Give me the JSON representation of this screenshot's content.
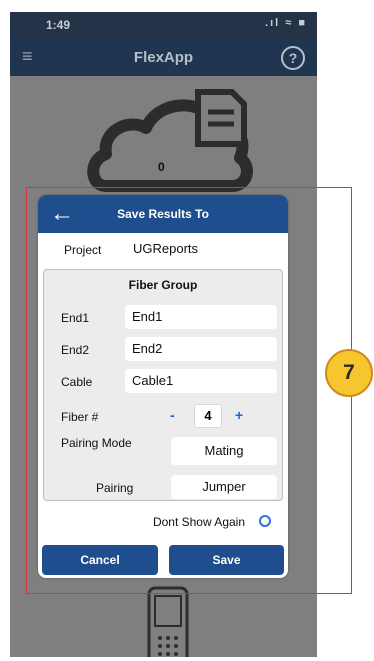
{
  "status_bar": {
    "time": "1:49",
    "icons": ".ıl ≈ ■"
  },
  "navbar": {
    "title": "FlexApp",
    "help_glyph": "?"
  },
  "background": {
    "cloud_count": "0"
  },
  "dialog": {
    "title": "Save Results To",
    "project": {
      "label": "Project",
      "value": "UGReports"
    },
    "fiber_group": {
      "title": "Fiber Group",
      "end1": {
        "label": "End1",
        "value": "End1"
      },
      "end2": {
        "label": "End2",
        "value": "End2"
      },
      "cable": {
        "label": "Cable",
        "value": "Cable1"
      },
      "fiber": {
        "label": "Fiber #",
        "minus": "-",
        "value": "4",
        "plus": "+"
      },
      "pairing_mode": {
        "label": "Pairing Mode",
        "value": "Mating"
      },
      "pairing": {
        "label": "Pairing",
        "value": "Jumper"
      }
    },
    "dont_show_again": "Dont Show Again",
    "cancel_label": "Cancel",
    "save_label": "Save"
  },
  "annotation": {
    "step": "7"
  },
  "colors": {
    "dialog_header": "#1f4e8f",
    "nav_bar": "#1f3550",
    "highlight_border": "#d9343b",
    "step_badge": "#f7c62f",
    "accent_blue": "#1f63d6"
  }
}
